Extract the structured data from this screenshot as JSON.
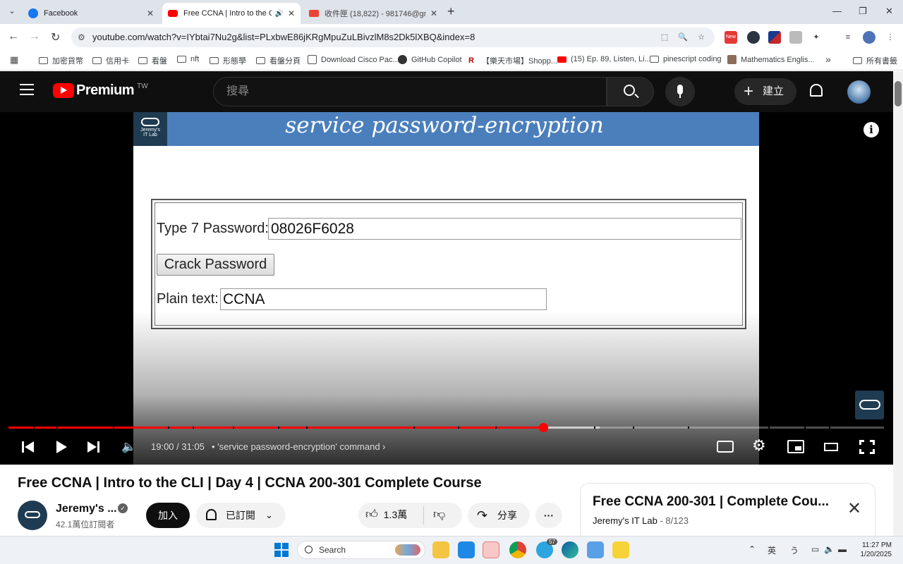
{
  "browser": {
    "tabs": [
      {
        "title": "Facebook",
        "active": false,
        "favicon": "facebook-icon",
        "color": "#1877f2"
      },
      {
        "title": "Free CCNA | Intro to the CLI",
        "active": true,
        "favicon": "youtube-icon",
        "color": "#ff0000",
        "audio": "speaker-icon"
      },
      {
        "title": "收件匣 (18,822) - 981746@gma",
        "active": false,
        "favicon": "gmail-icon",
        "color": "#ea4335"
      }
    ],
    "new_tab": "+",
    "url": "youtube.com/watch?v=IYbtai7Nu2g&list=PLxbwE86jKRgMpuZuLBivzlM8s2Dk5lXBQ&index=8",
    "ext_new_badge": "New",
    "bookmarks": [
      {
        "label": "加密貨幣",
        "type": "folder"
      },
      {
        "label": "信用卡",
        "type": "folder"
      },
      {
        "label": "看盤",
        "type": "folder"
      },
      {
        "label": "nft",
        "type": "folder"
      },
      {
        "label": "形態學",
        "type": "folder"
      },
      {
        "label": "看盤分頁",
        "type": "folder"
      },
      {
        "label": "Download Cisco Pac...",
        "type": "page"
      },
      {
        "label": "GitHub Copilot",
        "type": "page"
      },
      {
        "label": "【樂天市場】Shopp...",
        "type": "page"
      },
      {
        "label": "(15) Ep. 89, Listen, Li...",
        "type": "page"
      },
      {
        "label": "pinescript coding",
        "type": "folder"
      },
      {
        "label": "Mathematics Englis...",
        "type": "page"
      },
      {
        "label": "»",
        "type": "more"
      },
      {
        "label": "所有書籤",
        "type": "folder"
      }
    ]
  },
  "youtube": {
    "logo_text": "Premium",
    "region": "TW",
    "search_placeholder": "搜尋",
    "create_label": "建立",
    "accent": "#ff0000"
  },
  "video": {
    "slide_title": "service password-encryption",
    "slide_logo_line1": "Jeremy's",
    "slide_logo_line2": "IT Lab",
    "type7_label": "Type 7 Password:",
    "type7_value": "08026F6028",
    "crack_button": "Crack Password",
    "plain_label": "Plain text:",
    "plain_value": "CCNA",
    "time_current": "19:00",
    "time_total": "31:05",
    "time_display": "19:00 / 31:05",
    "chapter": "'service password-encryption' command",
    "progress": 0.611,
    "buffered": 0.675
  },
  "details": {
    "title": "Free CCNA | Intro to the CLI | Day 4 | CCNA 200-301 Complete Course",
    "channel": "Jeremy's ...",
    "subscribers": "42.1萬位訂閱者",
    "join": "加入",
    "subscribed": "已訂閱",
    "likes": "1.3萬",
    "share": "分享",
    "more": "···"
  },
  "playlist": {
    "title": "Free CCNA 200-301 | Complete Cou...",
    "channel": "Jeremy's IT Lab",
    "position": "- 8/123"
  },
  "taskbar": {
    "search": "Search",
    "ime": "英",
    "time": "11:27 PM",
    "date": "1/20/2025",
    "telegram_badge": "57"
  }
}
